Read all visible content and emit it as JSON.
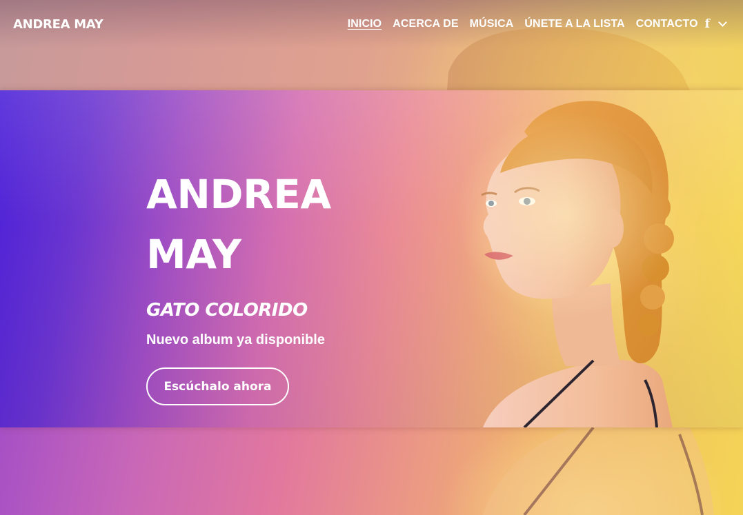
{
  "header": {
    "logo": "ANDREA MAY",
    "nav": [
      {
        "label": "INICIO",
        "active": true
      },
      {
        "label": "ACERCA DE"
      },
      {
        "label": "MÚSICA"
      },
      {
        "label": "ÚNETE A LA LISTA"
      },
      {
        "label": "CONTACTO"
      }
    ],
    "social_icon": "facebook-icon",
    "social_glyph": "f",
    "dropdown_icon": "chevron-down-icon"
  },
  "hero": {
    "title_line1": "ANDREA",
    "title_line2": "MAY",
    "album": "GATO COLORIDO",
    "subtitle": "Nuevo album ya disponible",
    "cta_label": "Escúchalo ahora"
  },
  "colors": {
    "gradient_start": "#4a1fd8",
    "gradient_mid": "#ea8b96",
    "gradient_end": "#f6dc58",
    "text": "#ffffff"
  }
}
